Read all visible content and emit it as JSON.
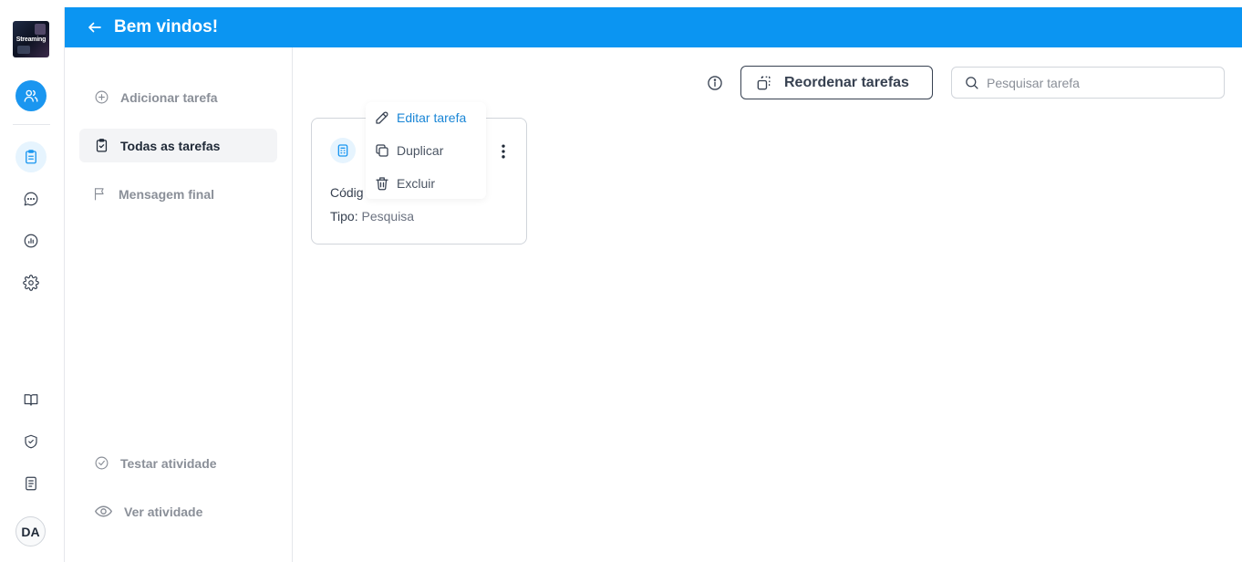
{
  "logo": {
    "text": "Streaming"
  },
  "header": {
    "title": "Bem vindos!"
  },
  "sidebar": {
    "items": [
      {
        "label": "Adicionar tarefa",
        "icon": "plus-circle-icon"
      },
      {
        "label": "Todas as tarefas",
        "icon": "clipboard-check-icon",
        "active": true
      },
      {
        "label": "Mensagem final",
        "icon": "flag-icon"
      }
    ],
    "bottom": [
      {
        "label": "Testar atividade",
        "icon": "check-circle-icon"
      },
      {
        "label": "Ver atividade",
        "icon": "eye-icon"
      }
    ]
  },
  "rail": {
    "icons": [
      "users-icon",
      "clipboard-icon",
      "chat-icon",
      "chart-icon",
      "gear-icon",
      "book-icon",
      "shield-check-icon",
      "document-icon"
    ],
    "avatar": "DA"
  },
  "toolbar": {
    "reorder_label": "Reordenar tarefas",
    "search_placeholder": "Pesquisar tarefa"
  },
  "card": {
    "code_label": "Códig",
    "type_label": "Tipo:",
    "type_value": "Pesquisa"
  },
  "menu": {
    "edit": "Editar tarefa",
    "duplicate": "Duplicar",
    "delete": "Excluir"
  },
  "colors": {
    "primary": "#0b95f2",
    "accent_light": "#e6f4fe",
    "edit_link": "#1a86d6"
  }
}
